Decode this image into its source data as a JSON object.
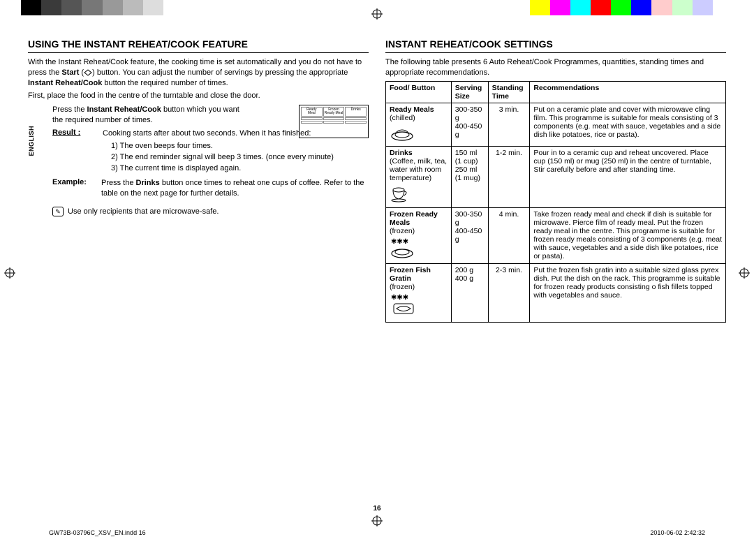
{
  "colorBar": [
    "#000",
    "#3a3a3a",
    "#555",
    "#777",
    "#999",
    "#bbb",
    "#ddd",
    "#fff",
    "#fff",
    "#fff",
    "#fff",
    "#fff",
    "#fff",
    "#fff",
    "#fff",
    "#fff",
    "#fff",
    "#fff",
    "#fff",
    "#fff",
    "#fff",
    "#fff",
    "#fff",
    "#fff",
    "#fff",
    "#ff0",
    "#f0f",
    "#0ff",
    "#f00",
    "#0f0",
    "#00f",
    "#fcc",
    "#cfc",
    "#ccf",
    "#fff"
  ],
  "englishTab": "ENGLISH",
  "left": {
    "heading": "USING THE INSTANT REHEAT/COOK FEATURE",
    "intro1a": "With the Instant Reheat/Cook feature, the cooking time is set automatically and you do not have to press the ",
    "intro1bold1": "Start",
    "intro1paren": " (",
    "intro1paren2": ") button. You can adjust the number of servings by pressing the appropriate ",
    "intro1bold2": "Instant Reheat/Cook",
    "intro1c": " button the required number of times.",
    "intro2": "First, place the food in the centre of the turntable and close the door.",
    "step1a": "Press the ",
    "step1bold": "Instant Reheat/Cook",
    "step1b": " button which you want the required number of times.",
    "resultLabel": "Result :",
    "resultText": "Cooking starts after about two seconds. When it has finished:",
    "results": [
      "1)  The oven beeps four times.",
      "2)  The end reminder signal will beep 3 times. (once every minute)",
      "3)  The current time is displayed again."
    ],
    "exampleLabel": "Example:",
    "exampleA": "Press the ",
    "exampleBold": "Drinks",
    "exampleB": " button once times to reheat one cups of coffee. Refer to the table on the next page for further details.",
    "note": "Use only recipients that are microwave-safe.",
    "panel": [
      "Ready Meal",
      "Frozen Ready Meal",
      "Drinks",
      "",
      "",
      "",
      "",
      "",
      ""
    ]
  },
  "right": {
    "heading": "INSTANT REHEAT/COOK SETTINGS",
    "intro": "The following table presents 6 Auto Reheat/Cook Programmes, quantities, standing times and appropriate recommendations.",
    "headers": {
      "food": "Food/ Button",
      "serving": "Serving Size",
      "standing": "Standing Time",
      "rec": "Recommendations"
    },
    "rows": [
      {
        "foodBold": "Ready Meals",
        "foodSub": "(chilled)",
        "icon": "plate",
        "serving": "300-350 g\n400-450 g",
        "standing": "3 min.",
        "rec": "Put on a ceramic plate and cover with microwave cling film. This programme is suitable for meals consisting of 3 components (e.g. meat with sauce, vegetables and a side dish like potatoes, rice or pasta)."
      },
      {
        "foodBold": "Drinks",
        "foodSub": "(Coffee, milk, tea, water with room temperature)",
        "icon": "cup",
        "serving": "150 ml\n(1 cup)\n250 ml\n(1 mug)",
        "standing": "1-2 min.",
        "rec": "Pour in to a ceramic cup and reheat uncovered. Place cup (150 ml) or mug (250 ml) in the centre of turntable, Stir carefully before and after standing time."
      },
      {
        "foodBold": "Frozen Ready Meals",
        "foodSub": "(frozen)",
        "icon": "frozen-plate",
        "serving": "300-350 g\n400-450 g",
        "standing": "4 min.",
        "rec": "Take frozen ready meal and check if dish is suitable for microwave. Pierce film of ready meal. Put the frozen ready meal in the centre. This programme is suitable for frozen ready meals consisting of 3 components (e.g. meat with sauce, vegetables and a side dish like potatoes, rice or pasta)."
      },
      {
        "foodBold": "Frozen Fish Gratin",
        "foodSub": "(frozen)",
        "icon": "frozen-fish",
        "serving": "200 g\n400 g",
        "standing": "2-3 min.",
        "rec": "Put the frozen fish gratin into a suitable sized glass pyrex dish. Put the dish on the rack. This programme is suitable for frozen ready products consisting o fish fillets topped with vegetables and sauce."
      }
    ]
  },
  "pageNumber": "16",
  "footer": {
    "left": "GW73B-03796C_XSV_EN.indd   16",
    "right": "2010-06-02   2:42:32"
  }
}
